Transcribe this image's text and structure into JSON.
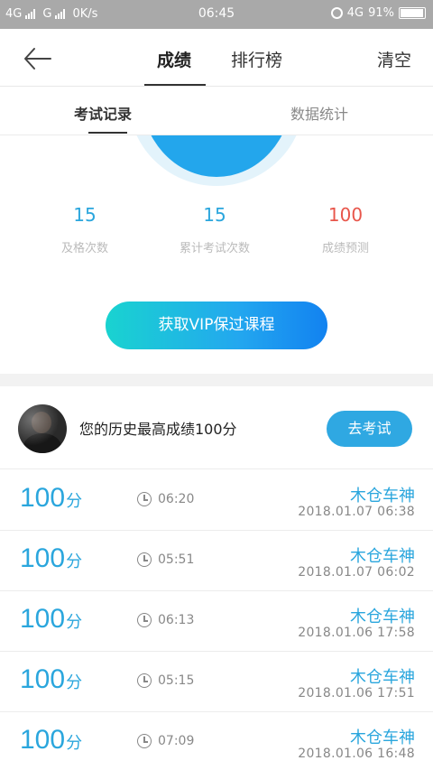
{
  "status_bar": {
    "signal1": "4G",
    "signal2": "G",
    "speed": "0K/s",
    "time": "06:45",
    "network": "4G",
    "battery": "91%"
  },
  "header": {
    "tabs": [
      {
        "label": "成绩"
      },
      {
        "label": "排行榜"
      }
    ],
    "clear_label": "清空",
    "back_icon": "arrow-left-icon"
  },
  "subtabs": [
    {
      "label": "考试记录"
    },
    {
      "label": "数据统计"
    }
  ],
  "stats": [
    {
      "value": "15",
      "label": "及格次数"
    },
    {
      "value": "15",
      "label": "累计考试次数"
    },
    {
      "value": "100",
      "label": "成绩预测"
    }
  ],
  "vip_button": "获取VIP保过课程",
  "profile": {
    "best_text": "您的历史最高成绩100分",
    "go_exam_label": "去考试"
  },
  "records": [
    {
      "score": "100",
      "unit": "分",
      "duration": "06:20",
      "name": "木仓车神",
      "date": "2018.01.07   06:38"
    },
    {
      "score": "100",
      "unit": "分",
      "duration": "05:51",
      "name": "木仓车神",
      "date": "2018.01.07   06:02"
    },
    {
      "score": "100",
      "unit": "分",
      "duration": "06:13",
      "name": "木仓车神",
      "date": "2018.01.06   17:58"
    },
    {
      "score": "100",
      "unit": "分",
      "duration": "05:15",
      "name": "木仓车神",
      "date": "2018.01.06   17:51"
    },
    {
      "score": "100",
      "unit": "分",
      "duration": "07:09",
      "name": "木仓车神",
      "date": "2018.01.06   16:48"
    }
  ],
  "colors": {
    "accent": "#2aa6dd",
    "prediction_red": "#e8564b",
    "status_bar": "#a9a9a9"
  }
}
